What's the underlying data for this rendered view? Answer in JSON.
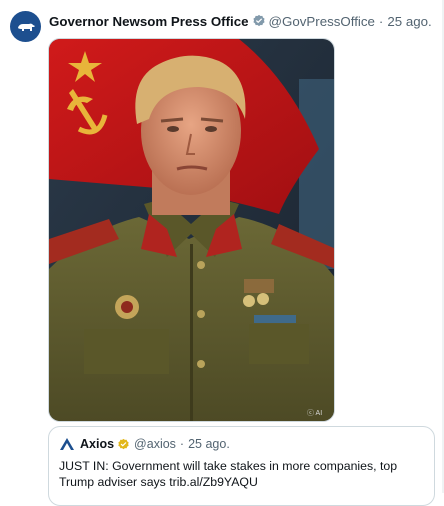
{
  "post": {
    "author_name": "Governor Newsom Press Office",
    "author_handle": "@GovPressOffice",
    "separator": "·",
    "time": "25 ago.",
    "avatar_icon": "california-bear-icon",
    "verified_icon": "gray-verified-badge-icon",
    "media": {
      "watermark": "ⓒ AI",
      "alt": "Generated image of Trump in a Soviet military uniform in front of a red hammer and sickle flag"
    }
  },
  "quoted_post": {
    "author_name": "Axios",
    "author_handle": "@axios",
    "separator": "·",
    "time": "25 ago.",
    "logo_icon": "axios-logo-icon",
    "verified_icon": "gold-verified-badge-icon",
    "text": "JUST IN: Government will take stakes in more companies, top Trump adviser says trib.al/Zb9YAQU"
  },
  "colors": {
    "link_blue": "#1d9bf0",
    "text_secondary": "#536471",
    "border": "#cfd9de",
    "gold_badge": "#e2b719",
    "gray_badge": "#829aab"
  }
}
